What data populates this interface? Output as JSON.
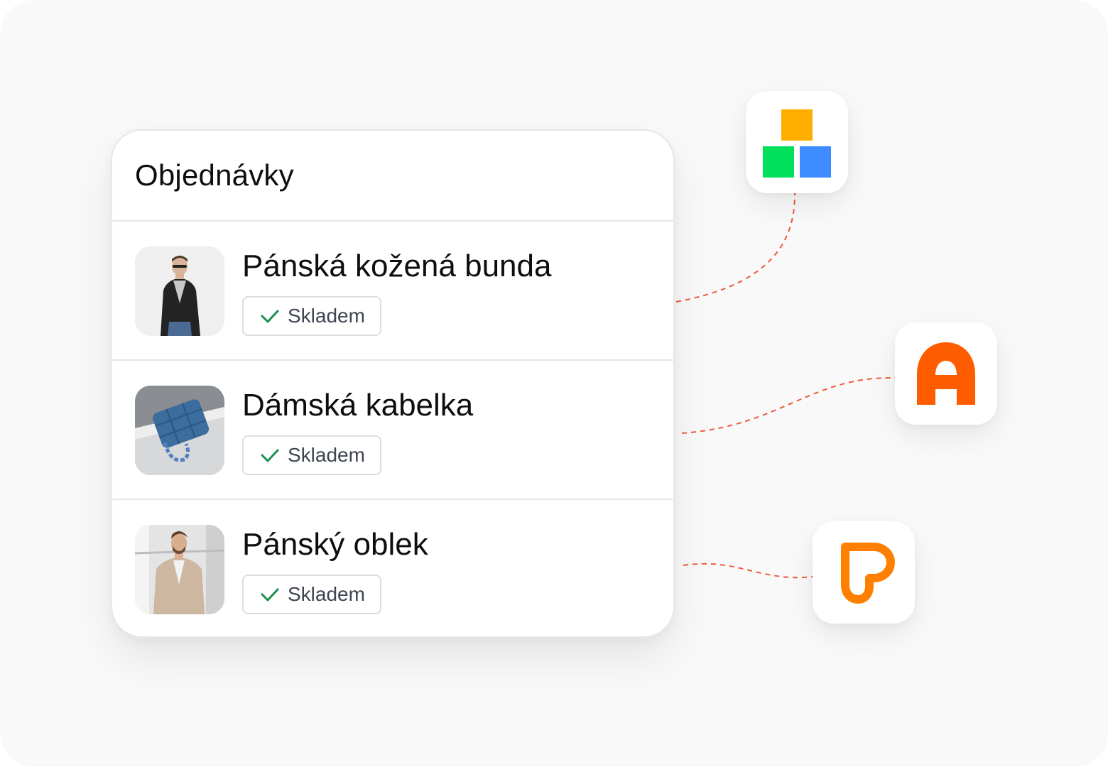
{
  "orders_card": {
    "title": "Objednávky",
    "items": [
      {
        "name": "Pánská kožená bunda",
        "stock_status": "Skladem",
        "image": "mens-leather-jacket-photo"
      },
      {
        "name": "Dámská kabelka",
        "stock_status": "Skladem",
        "image": "womens-handbag-photo"
      },
      {
        "name": "Pánský oblek",
        "stock_status": "Skladem",
        "image": "mens-suit-photo"
      }
    ]
  },
  "integrations": [
    {
      "icon": "blocks-logo-icon",
      "colors": [
        "#ffae00",
        "#00e05a",
        "#3d8bff"
      ]
    },
    {
      "icon": "letter-a-logo-icon",
      "color": "#ff5c00"
    },
    {
      "icon": "heart-p-logo-icon",
      "color": "#ff8000"
    }
  ],
  "colors": {
    "connector": "#f05a3c",
    "check": "#1a8f4e",
    "badge_text": "#3e4450",
    "background": "#f9f9f9"
  }
}
